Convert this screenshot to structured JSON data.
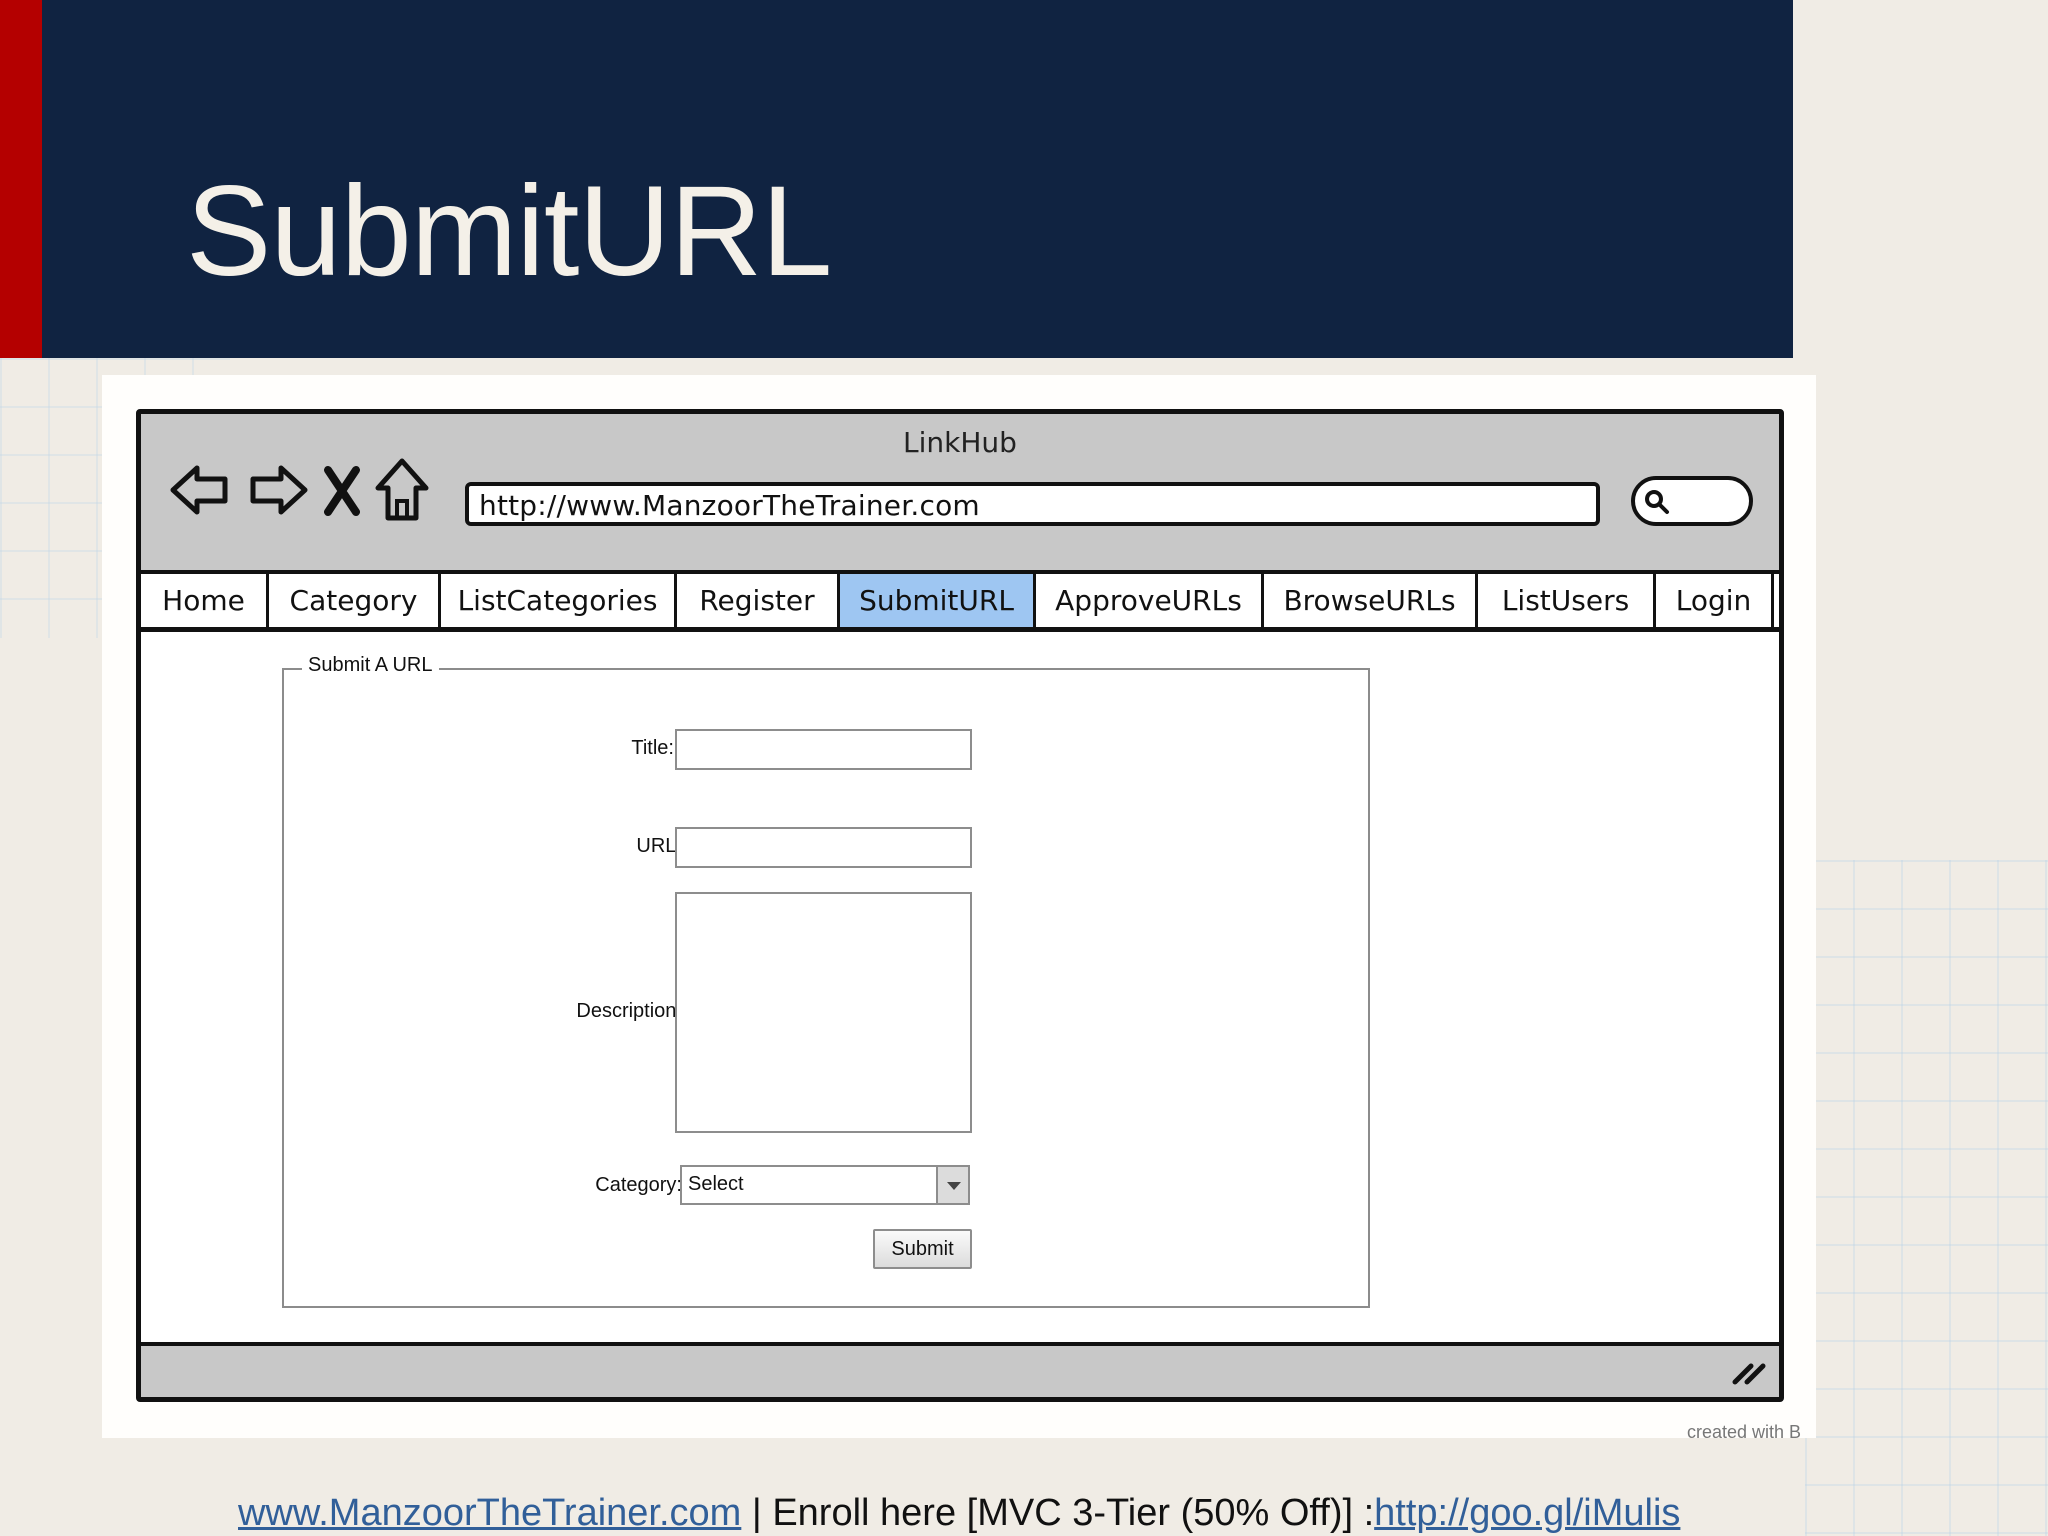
{
  "slide": {
    "title": "SubmitURL"
  },
  "browser": {
    "window_title": "LinkHub",
    "address": "http://www.ManzoorTheTrainer.com",
    "search_icon": "search-icon",
    "nav_icons": [
      "back-arrow-icon",
      "forward-arrow-icon",
      "close-icon",
      "home-icon"
    ]
  },
  "tabs": [
    {
      "label": "Home",
      "active": false
    },
    {
      "label": "Category",
      "active": false
    },
    {
      "label": "ListCategories",
      "active": false
    },
    {
      "label": "Register",
      "active": false
    },
    {
      "label": "SubmitURL",
      "active": true
    },
    {
      "label": "ApproveURLs",
      "active": false
    },
    {
      "label": "BrowseURLs",
      "active": false
    },
    {
      "label": "ListUsers",
      "active": false
    },
    {
      "label": "Login",
      "active": false
    }
  ],
  "form": {
    "legend": "Submit A URL",
    "title_label": "Title:",
    "title_value": "",
    "url_label": "URL:",
    "url_value": "",
    "description_label": "Description:",
    "description_value": "",
    "category_label": "Category:",
    "category_selected": "Select",
    "submit_label": "Submit"
  },
  "watermark": {
    "created_with": "created with B"
  },
  "footer": {
    "site_link": "www.ManzoorTheTrainer.com",
    "middle_text": " | Enroll here [MVC 3-Tier (50% Off)] :",
    "enroll_link": "http://goo.gl/iMulis"
  },
  "colors": {
    "header_background": "#102341",
    "accent_red": "#b40000",
    "active_tab": "#9ec6f2",
    "link_blue": "#315f99"
  }
}
